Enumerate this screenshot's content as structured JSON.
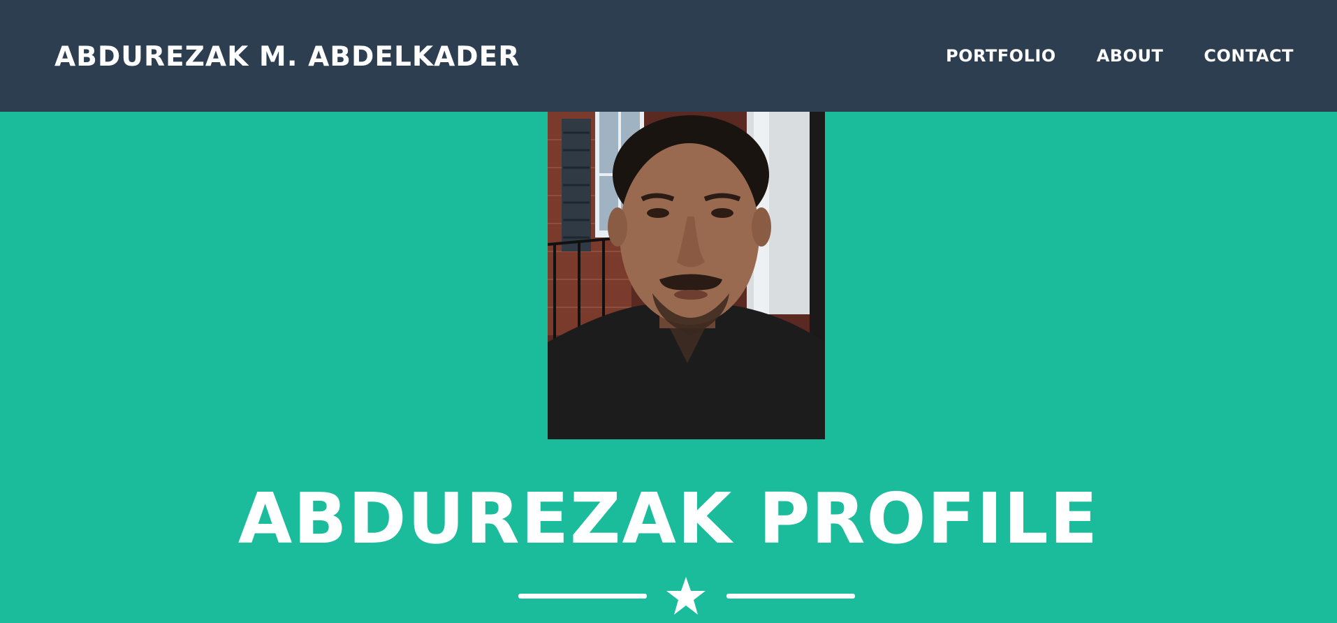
{
  "navbar": {
    "brand": "ABDUREZAK M. ABDELKADER",
    "links": [
      "PORTFOLIO",
      "ABOUT",
      "CONTACT"
    ]
  },
  "masthead": {
    "heading": "ABDUREZAK PROFILE",
    "divider_icon": "star-icon"
  },
  "colors": {
    "navbar_bg": "#2c3e50",
    "masthead_bg": "#1abc9c",
    "text": "#ffffff"
  }
}
